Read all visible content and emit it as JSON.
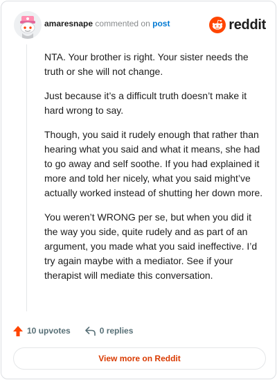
{
  "header": {
    "username": "amaresnape",
    "commented_on": "commented on",
    "post_link": "post",
    "brand": "reddit"
  },
  "comment": {
    "paragraphs": [
      "NTA. Your brother is right. Your sister needs the truth or she will not change.",
      "Just because it’s a difficult truth doesn’t make it hard wrong to say.",
      "Though, you said it rudely enough that rather than hearing what you said and what it means, she had to go away and self soothe. If you had explained it more and told her nicely, what you said might’ve actually worked instead of shutting her down more.",
      "You weren’t WRONG per se, but when you did it the way you side, quite rudely and as part of an argument, you made what you said ineffective. I’d try again maybe with a mediator. See if your therapist will mediate this conversation."
    ]
  },
  "actions": {
    "upvotes": "10 upvotes",
    "replies": "0 replies"
  },
  "view_more": "View more on Reddit",
  "colors": {
    "brand_orange": "#ff4500",
    "link_blue": "#0079d3",
    "button_text": "#d93a00"
  }
}
